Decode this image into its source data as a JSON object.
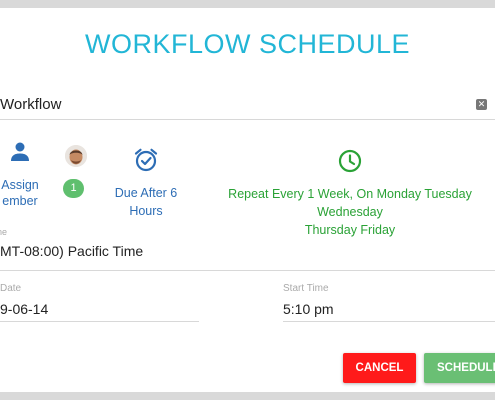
{
  "dialog": {
    "title": "WORKFLOW SCHEDULE"
  },
  "workflow": {
    "value": "Workflow"
  },
  "assign": {
    "line1": "Assign",
    "line2": "ember"
  },
  "assignees": {
    "count": "1"
  },
  "due": {
    "line1": "Due After 6",
    "line2": "Hours"
  },
  "repeat": {
    "line1": "Repeat Every 1 Week, On Monday Tuesday Wednesday",
    "line2": "Thursday Friday"
  },
  "timezone": {
    "label": "one",
    "value": "MT-08:00) Pacific Time"
  },
  "start_date": {
    "label": "Date",
    "value": "9-06-14"
  },
  "start_time": {
    "label": "Start Time",
    "value": "5:10 pm"
  },
  "actions": {
    "cancel": "CANCEL",
    "schedule": "SCHEDULE"
  },
  "colors": {
    "title": "#22b6d6",
    "link_blue": "#2d6db5",
    "repeat_green": "#2aa236",
    "cancel_red": "#ff1a1a",
    "schedule_green": "#6abf74",
    "badge_green": "#5fbf6e"
  },
  "icons": {
    "assign": "person-icon",
    "due": "alarm-clock-icon",
    "repeat": "clock-icon",
    "close": "close-icon"
  }
}
